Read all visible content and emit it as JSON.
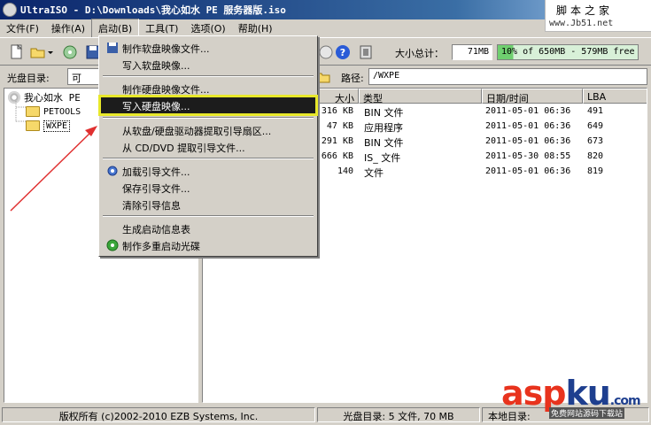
{
  "window": {
    "title": "UltraISO - D:\\Downloads\\我心如水 PE 服务器版.iso"
  },
  "watermark": {
    "chars": [
      "脚",
      "本",
      "之",
      "家"
    ],
    "url": "www.Jb51.net"
  },
  "menubar": {
    "items": [
      {
        "label": "文件(F)"
      },
      {
        "label": "操作(A)"
      },
      {
        "label": "启动(B)"
      },
      {
        "label": "工具(T)"
      },
      {
        "label": "选项(O)"
      },
      {
        "label": "帮助(H)"
      }
    ]
  },
  "toolbar": {
    "size_total_label": "大小总计：",
    "size_total_value": "71MB",
    "usage_text": "10% of 650MB - 579MB free",
    "usage_fraction": 0.11
  },
  "pathbar": {
    "cd_label": "光盘目录:",
    "cd_value": "可",
    "path_label": "路径:",
    "path_value": "/WXPE"
  },
  "tree": {
    "root": "我心如水 PE",
    "children": [
      "PETOOLS",
      "WXPE"
    ]
  },
  "filelist": {
    "headers": {
      "size": "大小",
      "type": "类型",
      "date": "日期/时间",
      "lba": "LBA"
    },
    "rows": [
      {
        "size": "316 KB",
        "type": "BIN 文件",
        "date": "2011-05-01 06:36",
        "lba": "491"
      },
      {
        "size": "47 KB",
        "type": "应用程序",
        "date": "2011-05-01 06:36",
        "lba": "649"
      },
      {
        "size": "291 KB",
        "type": "BIN 文件",
        "date": "2011-05-01 06:36",
        "lba": "673"
      },
      {
        "size": "666 KB",
        "type": "IS_ 文件",
        "date": "2011-05-30 08:55",
        "lba": "820"
      },
      {
        "size": "140",
        "type": "文件",
        "date": "2011-05-01 06:36",
        "lba": "819"
      }
    ]
  },
  "boot_menu": {
    "items": [
      "制作软盘映像文件...",
      "写入软盘映像...",
      "制作硬盘映像文件...",
      "写入硬盘映像...",
      "从软盘/硬盘驱动器提取引导扇区...",
      "从 CD/DVD 提取引导文件...",
      "加载引导文件...",
      "保存引导文件...",
      "清除引导信息",
      "生成启动信息表",
      "制作多重启动光碟"
    ]
  },
  "statusbar": {
    "copyright": "版权所有 (c)2002-2010 EZB Systems, Inc.",
    "cd_info": "光盘目录: 5 文件, 70 MB",
    "local_info": "本地目录:"
  },
  "branding": {
    "text_a": "asp",
    "text_b": "ku",
    "suffix": ".com",
    "sub": "免费网站源码下载站"
  },
  "colors": {
    "highlight_outline": "#e8e82a",
    "arrow": "#e03030",
    "brand_red": "#e8331d",
    "brand_blue": "#1e3f8f"
  }
}
